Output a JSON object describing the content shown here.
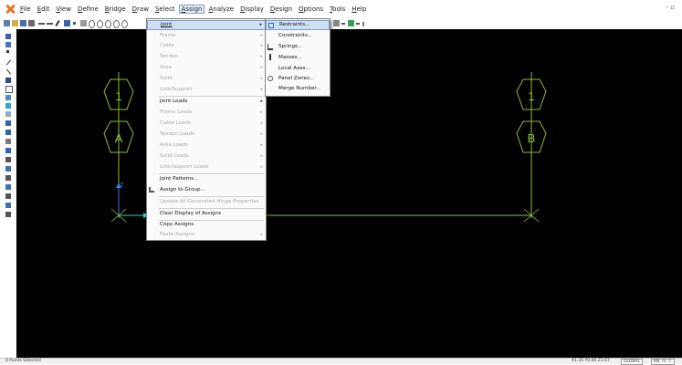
{
  "menubar": {
    "items": [
      {
        "label": "File",
        "mnemonic": "F",
        "rest": "ile"
      },
      {
        "label": "Edit",
        "mnemonic": "E",
        "rest": "dit"
      },
      {
        "label": "View",
        "mnemonic": "V",
        "rest": "iew"
      },
      {
        "label": "Define",
        "mnemonic": "D",
        "rest": "efine"
      },
      {
        "label": "Bridge",
        "mnemonic": "B",
        "rest": "ridge"
      },
      {
        "label": "Draw",
        "mnemonic": "D",
        "rest": "raw"
      },
      {
        "label": "Select",
        "mnemonic": "S",
        "rest": "elect"
      },
      {
        "label": "Assign",
        "mnemonic": "A",
        "rest": "ssign"
      },
      {
        "label": "Analyze",
        "mnemonic": "A",
        "rest": "nalyze"
      },
      {
        "label": "Display",
        "mnemonic": "D",
        "rest": "isplay"
      },
      {
        "label": "Design",
        "mnemonic": "D",
        "rest": "esign"
      },
      {
        "label": "Options",
        "mnemonic": "O",
        "rest": "ptions"
      },
      {
        "label": "Tools",
        "mnemonic": "T",
        "rest": "ools"
      },
      {
        "label": "Help",
        "mnemonic": "H",
        "rest": "elp"
      }
    ],
    "minimize_glyph": "- ▫"
  },
  "assign_menu": {
    "items": [
      {
        "label": "Joint",
        "enabled": true,
        "submenu": true,
        "highlight": true
      },
      {
        "label": "Frame",
        "enabled": false,
        "submenu": true
      },
      {
        "label": "Cable",
        "enabled": false,
        "submenu": true
      },
      {
        "label": "Tendon",
        "enabled": false,
        "submenu": true
      },
      {
        "label": "Area",
        "enabled": false,
        "submenu": true
      },
      {
        "label": "Solid",
        "enabled": false,
        "submenu": true
      },
      {
        "label": "Link/Support",
        "enabled": false,
        "submenu": true
      },
      {
        "label": "Joint Loads",
        "enabled": true,
        "submenu": true
      },
      {
        "label": "Frame Loads",
        "enabled": false,
        "submenu": true
      },
      {
        "label": "Cable Loads",
        "enabled": false,
        "submenu": true
      },
      {
        "label": "Tendon Loads",
        "enabled": false,
        "submenu": true
      },
      {
        "label": "Area Loads",
        "enabled": false,
        "submenu": true
      },
      {
        "label": "Solid Loads",
        "enabled": false,
        "submenu": true
      },
      {
        "label": "Link/Support Loads",
        "enabled": false,
        "submenu": true
      },
      {
        "label": "Joint Patterns...",
        "enabled": true,
        "submenu": false
      },
      {
        "label": "Assign to Group...",
        "enabled": true,
        "submenu": false
      },
      {
        "label": "Update All Generated Hinge Properties",
        "enabled": false,
        "submenu": false
      },
      {
        "label": "Clear Display of Assigns",
        "enabled": true,
        "submenu": false
      },
      {
        "label": "Copy Assigns",
        "enabled": true,
        "submenu": false
      },
      {
        "label": "Paste Assigns",
        "enabled": false,
        "submenu": true
      }
    ],
    "submenu_arrow": "▸"
  },
  "joint_submenu": {
    "items": [
      {
        "label": "Restraints...",
        "icon": "restraints-icon",
        "highlight": true
      },
      {
        "label": "Constraints...",
        "icon": ""
      },
      {
        "label": "Springs...",
        "icon": "springs-icon"
      },
      {
        "label": "Masses...",
        "icon": "masses-icon"
      },
      {
        "label": "Local Axes...",
        "icon": ""
      },
      {
        "label": "Panel Zones...",
        "icon": "panel-zones-icon"
      },
      {
        "label": "Merge Number...",
        "icon": ""
      }
    ]
  },
  "canvas": {
    "grid_markers": [
      {
        "label": "1",
        "id": "left-top"
      },
      {
        "label": "A",
        "id": "left-bottom"
      },
      {
        "label": "1",
        "id": "right-top"
      },
      {
        "label": "B",
        "id": "right-bottom"
      }
    ],
    "axis_label": "Z",
    "colors": {
      "background": "#000000",
      "grid": "#8fbc3a",
      "member": "#7fbf5f",
      "axis_z": "#3a7ad8",
      "axis_x": "#2fd0c0"
    }
  },
  "statusbar": {
    "left_text": "0 Points Selected",
    "coords": "X1.35 Y0.00 Z1.67",
    "coord_system": "GLOBAL",
    "units": "KN, m, C"
  }
}
